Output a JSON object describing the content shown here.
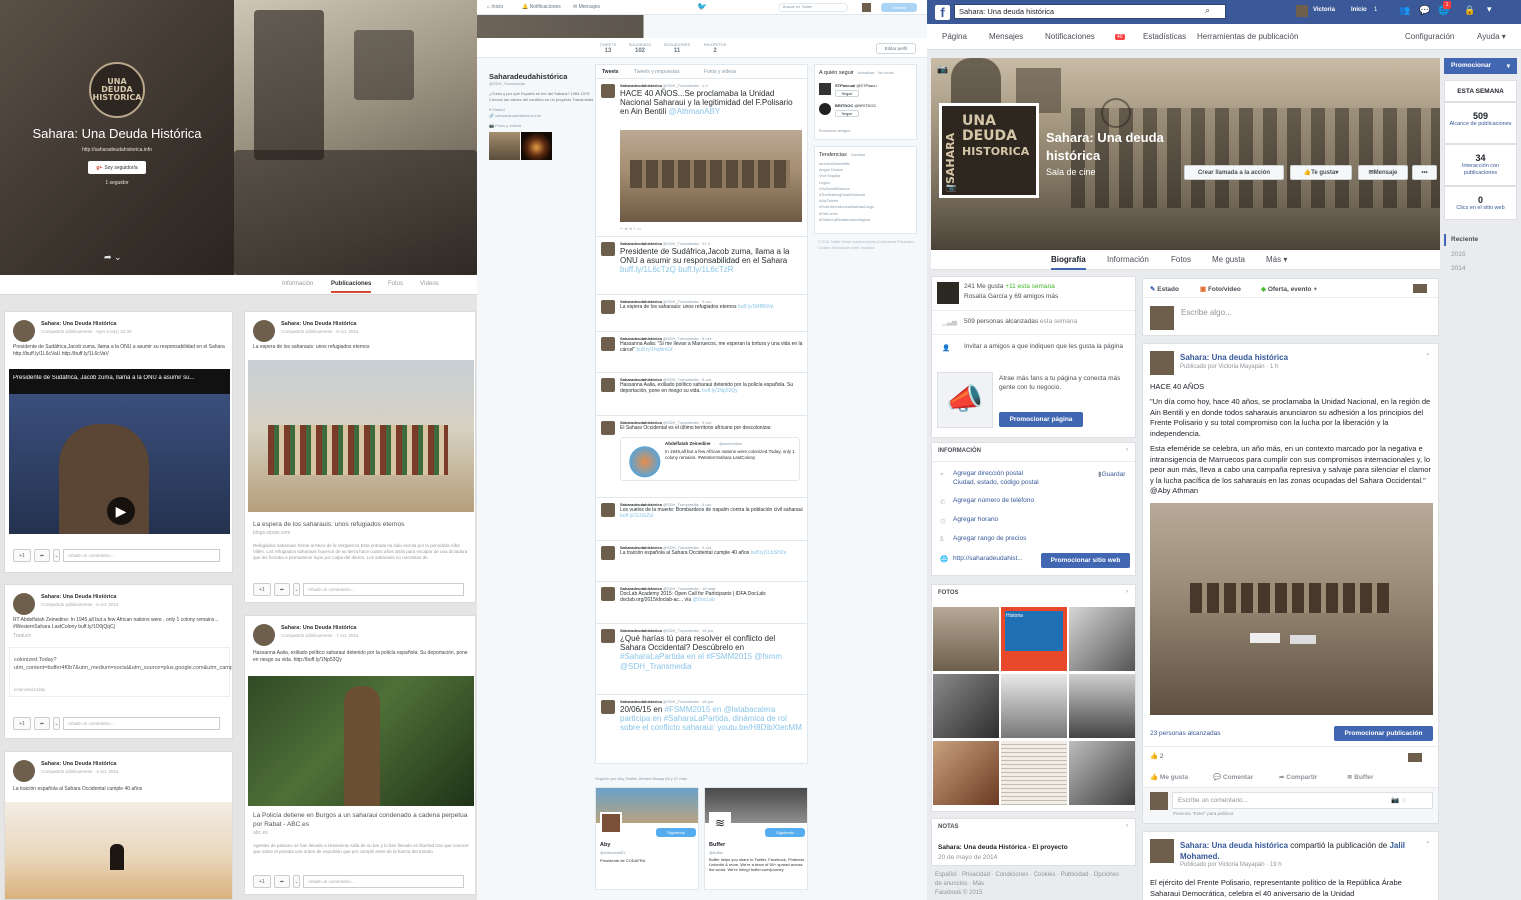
{
  "googleplus": {
    "page_title": "Sahara: Una Deuda Histórica",
    "url": "http://saharadeudahistorica.info",
    "follow_button": "Soy seguidor/a",
    "followers": "1 seguidor",
    "logo_lines": [
      "SAHARA",
      "UNA",
      "DEUDA",
      "HISTORICA"
    ],
    "tabs": [
      "Información",
      "Publicaciones",
      "Fotos",
      "Vídeos"
    ],
    "active_tab": "Publicaciones",
    "author": "Sahara: Una Deuda Histórica",
    "plus_one": "+1",
    "comment_placeholder": "Añade un comentario...",
    "posts": [
      {
        "meta": "Compartido públicamente  ·  Ayer a la(s) 22:30",
        "text": "Presidente de Sudáfrica,Jacob zuma, llama a la ONU a asumir su responsabilidad en el Sahara http://buff.ly/1L6cVaU http://buff.ly/1L6cVaV",
        "video_title": "Presidente de Sudáfrica, Jacob zuma, llama a la ONU a asumir su..."
      },
      {
        "meta": "Compartido públicamente  ·  9 oct. 2015",
        "text": "La espera de los saharauis: unos refugiados eternos",
        "link_title": "La espera de los saharauis: unos refugiados eternos",
        "link_domain": "blogs.elpais.com",
        "link_desc": "Refugiados saharauis frente al Muro de la Vergüenza Esta entrada ha sido escrita por la periodista Alba Villén. Los refugiados saharauis huyeron de su tierra hace cuatro años atrás para escapar de una dictadura que les forzaba a permanecer lejos por culpa del dinero. Los saharauis no necesitan de"
      },
      {
        "meta": "Compartido públicamente  ·  5 oct. 2015",
        "text": "RT Abdelfatah Zeinedine: In 1945,all but a few African nations were , only 1 colony remains... #WesternSahara LastColony buff.ly/1O0jQqCj",
        "translate": "Traducir",
        "link_title": "colonized.Today?utm_content=buffer4f0b7&utm_medium=social&utm_source=plus.google.com&utm_campaign=buffer",
        "link_domain": "colonized.today"
      },
      {
        "meta": "Compartido públicamente  ·  7 oct. 2015",
        "text": "Hassanna Aalia, exiliado político saharaui detenido por la policía española: Su deportación, pone en riesgo su vida. http://buff.ly/1Np53Qy",
        "link_title": "La Policía detiene en Burgos a un saharaui condenado a cadena perpetua por Rabat - ABC.es",
        "link_domain": "abc.es",
        "link_desc": "Agentes de paisano se han llevado a Hassanna Aalia de su bar y lo han llevado en libertad tras que conocer que sobre él pesaba una orden de expulsión que por cumplir entre de la fuerza del Estado"
      },
      {
        "meta": "Compartido públicamente  ·  4 oct. 2015",
        "text": "La traición española al Sahara Occidental cumple 40 años"
      }
    ]
  },
  "twitter": {
    "nav": [
      "Inicio",
      "Notificaciones",
      "Mensajes"
    ],
    "search_placeholder": "Buscar en Twitter",
    "tweet_button": "Twittear",
    "stats": [
      {
        "label": "TWEETS",
        "value": "13"
      },
      {
        "label": "SIGUIENDO",
        "value": "102"
      },
      {
        "label": "SEGUIDORES",
        "value": "11"
      },
      {
        "label": "FAVORITOS",
        "value": "2"
      }
    ],
    "edit_profile": "Editar perfil",
    "profile_name": "Saharadeudahistórica",
    "handle": "@SDH_Transmedia",
    "bio": "¿Cómo y por qué España se fue del Sahara? 1960-1976 Conoce las claves del conflicto en un proyecto Transmedia",
    "location": "Madrid",
    "website": "saharadeudahistorica.info",
    "photos_label": "Fotos y vídeos",
    "tabs": [
      "Tweets",
      "Tweets y respuestas",
      "Fotos y videos"
    ],
    "tweets": [
      {
        "meta": "@SDH_Transmedia · 1 h",
        "text": "HACE 40 AÑOS...Se proclamaba la Unidad Nacional Saharaui y la legitimidad del F.Polisario en Ain Bentili",
        "mention": "@AthmanABY"
      },
      {
        "meta": "@SDH_Transmedia · 21 h",
        "text": "Presidente de Sudáfrica,Jacob zuma, llama a la ONU a asumir su responsabilidad en el Sahara",
        "mention": "buff.ly/1L6cTzQ buff.ly/1L6cTzR"
      },
      {
        "meta": "@SDH_Transmedia · 9 oct.",
        "text": "La espera de los saharauis: unos refugiados eternos",
        "mention": "buff.ly/1MfBNVa"
      },
      {
        "meta": "@SDH_Transmedia · 8 oct.",
        "text": "Hassanna Aalia: \"Si me llevan a Marruecos, me esperan la tortura y una vida en la cárcel\"",
        "mention": "buff.ly/1hqNmGf"
      },
      {
        "meta": "@SDH_Transmedia · 8 oct.",
        "text": "Hassanna Aalia, exiliado político saharaui detenido por la policía española. Su deportación, pone en riesgo su vida.",
        "mention": "buff.ly/1Np53Qy"
      },
      {
        "meta": "@SDH_Transmedia · 5 oct.",
        "text": "El Sahara Occidental es el último territorio africano por descolonizar.",
        "mention": "",
        "quote_name": "Abdelfatah Zeinedine",
        "quote_handle": "@azeinedine",
        "quote_text": "In 1945,all but a few African nations were colonized.Today, only 1 colony remains. #WesternSahara LastColony"
      },
      {
        "meta": "@SDH_Transmedia · 4 oct.",
        "text": "Los vuelos de la muerte: Bombardeos de napalm contra la población civil saharaui",
        "mention": "buff.ly/1LbSZuI"
      },
      {
        "meta": "@SDH_Transmedia · 4 oct.",
        "text": "La traición española al Sahara Occidental cumple 40 años",
        "mention": "buff.ly/1LbSHZe"
      },
      {
        "meta": "@SDH_Transmedia · 18 sept.",
        "text": "DocLab Academy 2015: Open Call for Participants | IDFA DocLab: doclab.org/2015/doclab-ac... vía",
        "mention": "@DocLab"
      },
      {
        "meta": "@SDH_Transmedia · 18 jun.",
        "text": "¿Qué harías tú para resolver el conflicto del Sahara Occidental? Descúbrelo en",
        "mention": "#SaharaLaPartida en el #FSMM2015 @fsmm @SDH_Transmedia"
      },
      {
        "meta": "@SDH_Transmedia · 18 jun.",
        "text": "20/06/15 en",
        "mention": "#FSMM2015 en @latabacalera participa en #SaharaLaPartida, dinámica de rol sobre el conflicto saharaui: youtu.be/H8DibXtecMM"
      }
    ],
    "tweet_author": "Saharadeudahistórica",
    "who_to_follow_title": "A quién seguir",
    "who_to_follow_links": "· Actualizar · Ver todos",
    "follow_suggestions": [
      {
        "name": "STPascual",
        "handle": "@STPascu"
      },
      {
        "name": "BRITDOC",
        "handle": "@BRITDOC"
      }
    ],
    "follow_btn": "Seguir",
    "find_friends": "Encontrar amigos",
    "trends_title": "Tendencias",
    "trends_change": "· Cambiar",
    "trends": [
      "#rumbo40medellin",
      "Angus Deaton",
      "Vive España",
      "Legión",
      "#YoAmoMiBanera",
      "#TheWalkingDeadSeason6",
      "#AlyTickets",
      "#SusinDirectionesMaoNasCargo",
      "#FeliLunes",
      "#DiaDeLaResistenciaIndigena"
    ],
    "footer": "© 2015 Twitter  Sobre nosotros  Ayuda  Condiciones  Privacidad  Cookies  Información sobre anuncios",
    "followed_by": "Seguido por Aby, Buffer, Ahmed Musay Ali y 47 más",
    "suggested": [
      {
        "name": "Aby",
        "handle": "@AthmanABY",
        "desc": "Presidente de CODAFRA"
      },
      {
        "name": "Buffer",
        "handle": "@buffer",
        "desc": "Buffer helps you share to Twitter, Facebook, Pinterest, LinkedIn & more. We're a team of 50+ spread across the world. We're hiring! buffer.com/journey"
      }
    ],
    "following_btn": "Siguiendo"
  },
  "facebook": {
    "search_value": "Sahara: Una deuda histórica",
    "user": "Victoria",
    "home": "Inicio",
    "home_count": "1",
    "notif_count": "1",
    "nav": [
      "Página",
      "Mensajes",
      "Notificaciones",
      "Estadísticas",
      "Herramientas de publicación"
    ],
    "notif_badge": "40",
    "nav_right": [
      "Configuración",
      "Ayuda"
    ],
    "page_name": "Sahara: Una deuda histórica",
    "category": "Sala de cine",
    "cover_buttons": [
      "Crear llamada a la acción",
      "Te gusta",
      "Mensaje",
      "•••"
    ],
    "page_tabs": [
      "Biografía",
      "Información",
      "Fotos",
      "Me gusta",
      "Más"
    ],
    "active_tab": "Biografía",
    "likes_line": "241 Me gusta",
    "likes_week": "+11 esta semana",
    "likes_friends": "Rosalía García y 69 amigos más",
    "reach": "509 personas alcanzadas",
    "reach_week": "esta semana",
    "invite": "Invitar a amigos a que indiquen que les gusta la página",
    "promo_text": "Atrae más fans a tu página y conecta más gente con tu negocio.",
    "promo_page_btn": "Promocionar página",
    "info_title": "INFORMACIÓN",
    "info_items": [
      "Agregar dirección postal",
      "Ciudad, estado, código postal",
      "Agregar número de teléfono",
      "Agregar horario",
      "Agregar rango de precios",
      "http://saharadeudahist..."
    ],
    "save": "Guardar",
    "promo_site_btn": "Promocionar sitio web",
    "photos_title": "FOTOS",
    "notes_title": "NOTAS",
    "note_title": "Sahara: Una deuda Histórica - El proyecto",
    "note_date": "20 de mayo de 2014",
    "footer_links": "Español · Privacidad · Condiciones · Cookies · Publicidad · Opciones de anuncios · Más",
    "copyright": "Facebook © 2015",
    "composer": [
      "Estado",
      "Foto/video",
      "Oferta, evento +"
    ],
    "composer_placeholder": "Escribe algo...",
    "post_author": "Sahara: Una deuda histórica",
    "post_meta": "Publicado por Victoria Mayapán · 1 h",
    "post_heading": "HACE 40 AÑOS",
    "post_text1": "\"Un día como hoy, hace 40 años, se proclamaba la Unidad Nacional, en la región de Ain Bentili y en donde todos saharauis anunciaron su adhesión a los principios del Frente Polisario y su total compromiso con la lucha por la liberación y la independencia.",
    "post_text2": "Esta efeméride se celebra, un año más, en un contexto marcado por la negativa e intransigencia de Marruecos para cumplir con sus compromisos internacionales y, lo peor aun más, lleva a cabo una campaña represiva y salvaje para silenciar el clamor y la lucha pacífica de los saharauis en las zonas ocupadas del Sahara Occidental.\" @Aby Athman",
    "post_reach": "23 personas alcanzadas",
    "promo_post_btn": "Promocionar publicación",
    "reaction_count": "2",
    "actions": [
      "Me gusta",
      "Comentar",
      "Compartir",
      "Buffer"
    ],
    "comment_placeholder": "Escribe un comentario...",
    "comment_hint": "Presiona \"Enter\" para publicar.",
    "post2_author": "Sahara: Una deuda histórica",
    "post2_shared": "compartió la publicación de",
    "post2_source": "Jalil Mohamed.",
    "post2_meta": "Publicado por Victoria Mayapán · 19 h",
    "post2_text": "El ejército del Frente Polisario, representante político de la República Árabe Saharaui Democrática, celebra el 40 aniversario de la Unidad",
    "promote_top": "Promocionar",
    "this_week": "ESTA SEMANA",
    "weekly": [
      {
        "value": "509",
        "label": "Alcance de publicaciones"
      },
      {
        "value": "34",
        "label": "Interacción con publicaciones"
      },
      {
        "value": "0",
        "label": "Clics en el sitio web"
      }
    ],
    "timeline_years": [
      "Reciente",
      "2015",
      "2014"
    ]
  }
}
